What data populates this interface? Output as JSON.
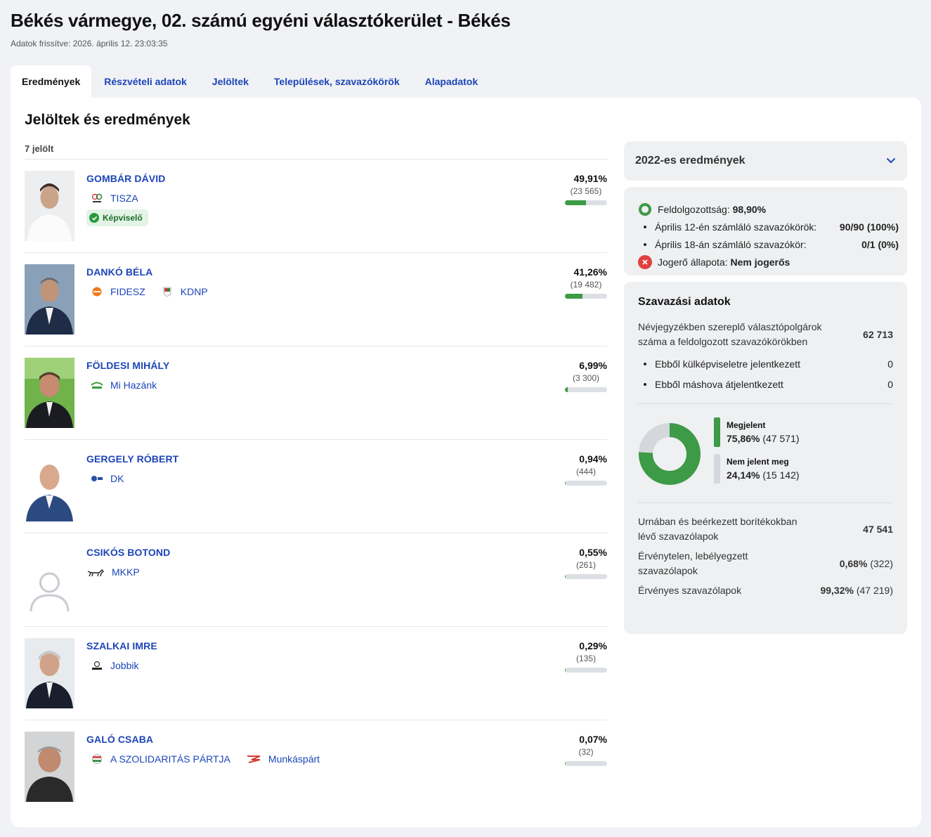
{
  "header": {
    "title": "Békés vármegye, 02. számú egyéni választókerület - Békés",
    "updated": "Adatok frissítve: 2026. április 12. 23:03:35"
  },
  "tabs": [
    {
      "label": "Eredmények",
      "active": true
    },
    {
      "label": "Részvételi adatok",
      "active": false
    },
    {
      "label": "Jelöltek",
      "active": false
    },
    {
      "label": "Települések, szavazókörök",
      "active": false
    },
    {
      "label": "Alapadatok",
      "active": false
    }
  ],
  "main": {
    "title": "Jelöltek és eredmények",
    "count": "7 jelölt",
    "badge_label": "Képviselő",
    "candidates": [
      {
        "name": "GOMBÁR DÁVID",
        "parties": [
          "TISZA"
        ],
        "pct": "49,91%",
        "votes": "(23 565)",
        "share": 0.4991,
        "elected": true,
        "photo": "photo"
      },
      {
        "name": "DANKÓ BÉLA",
        "parties": [
          "FIDESZ",
          "KDNP"
        ],
        "pct": "41,26%",
        "votes": "(19 482)",
        "share": 0.4126,
        "elected": false,
        "photo": "photo"
      },
      {
        "name": "FÖLDESI MIHÁLY",
        "parties": [
          "Mi Hazánk"
        ],
        "pct": "6,99%",
        "votes": "(3 300)",
        "share": 0.0699,
        "elected": false,
        "photo": "photo"
      },
      {
        "name": "GERGELY RÓBERT",
        "parties": [
          "DK"
        ],
        "pct": "0,94%",
        "votes": "(444)",
        "share": 0.0094,
        "elected": false,
        "photo": "photo"
      },
      {
        "name": "CSIKÓS BOTOND",
        "parties": [
          "MKKP"
        ],
        "pct": "0,55%",
        "votes": "(261)",
        "share": 0.0055,
        "elected": false,
        "photo": "placeholder"
      },
      {
        "name": "SZALKAI IMRE",
        "parties": [
          "Jobbik"
        ],
        "pct": "0,29%",
        "votes": "(135)",
        "share": 0.0029,
        "elected": false,
        "photo": "photo"
      },
      {
        "name": "GALÓ CSABA",
        "parties": [
          "A SZOLIDARITÁS PÁRTJA",
          "Munkáspárt"
        ],
        "pct": "0,07%",
        "votes": "(32)",
        "share": 0.0007,
        "elected": false,
        "photo": "photo"
      }
    ]
  },
  "side": {
    "accordion": "2022-es eredmények",
    "processing": {
      "label": "Feldolgozottság:",
      "value": "98,90%",
      "rows": [
        {
          "label": "Április 12-én számláló szavazókörök:",
          "count": "90/90",
          "pct": "(100%)"
        },
        {
          "label": "Április 18-án számláló szavazókör:",
          "count": "0/1",
          "pct": "(0%)"
        }
      ],
      "legal_label": "Jogerő állapota:",
      "legal_value": "Nem jogerős"
    },
    "voting": {
      "title": "Szavazási adatok",
      "registered_label": "Névjegyzékben szereplő választópolgárok száma a feldolgozott szavazókörökben",
      "registered_value": "62 713",
      "sub": [
        {
          "label": "Ebből külképviseletre jelentkezett",
          "value": "0"
        },
        {
          "label": "Ebből máshova átjelentkezett",
          "value": "0"
        }
      ],
      "turnout": {
        "present_label": "Megjelent",
        "present_pct": "75,86%",
        "present_count": "(47 571)",
        "absent_label": "Nem jelent meg",
        "absent_pct": "24,14%",
        "absent_count": "(15 142)",
        "share": 0.7586
      },
      "ballots": [
        {
          "label": "Urnában és beérkezett borítékokban lévő szavazólapok",
          "pct": "47 541",
          "count": ""
        },
        {
          "label": "Érvénytelen, lebélyegzett szavazólapok",
          "pct": "0,68%",
          "count": "(322)"
        },
        {
          "label": "Érvényes szavazólapok",
          "pct": "99,32%",
          "count": "(47 219)"
        }
      ]
    },
    "colors": {
      "present": "#3d9a47",
      "absent": "#d4d7db",
      "error": "#e04040"
    }
  }
}
